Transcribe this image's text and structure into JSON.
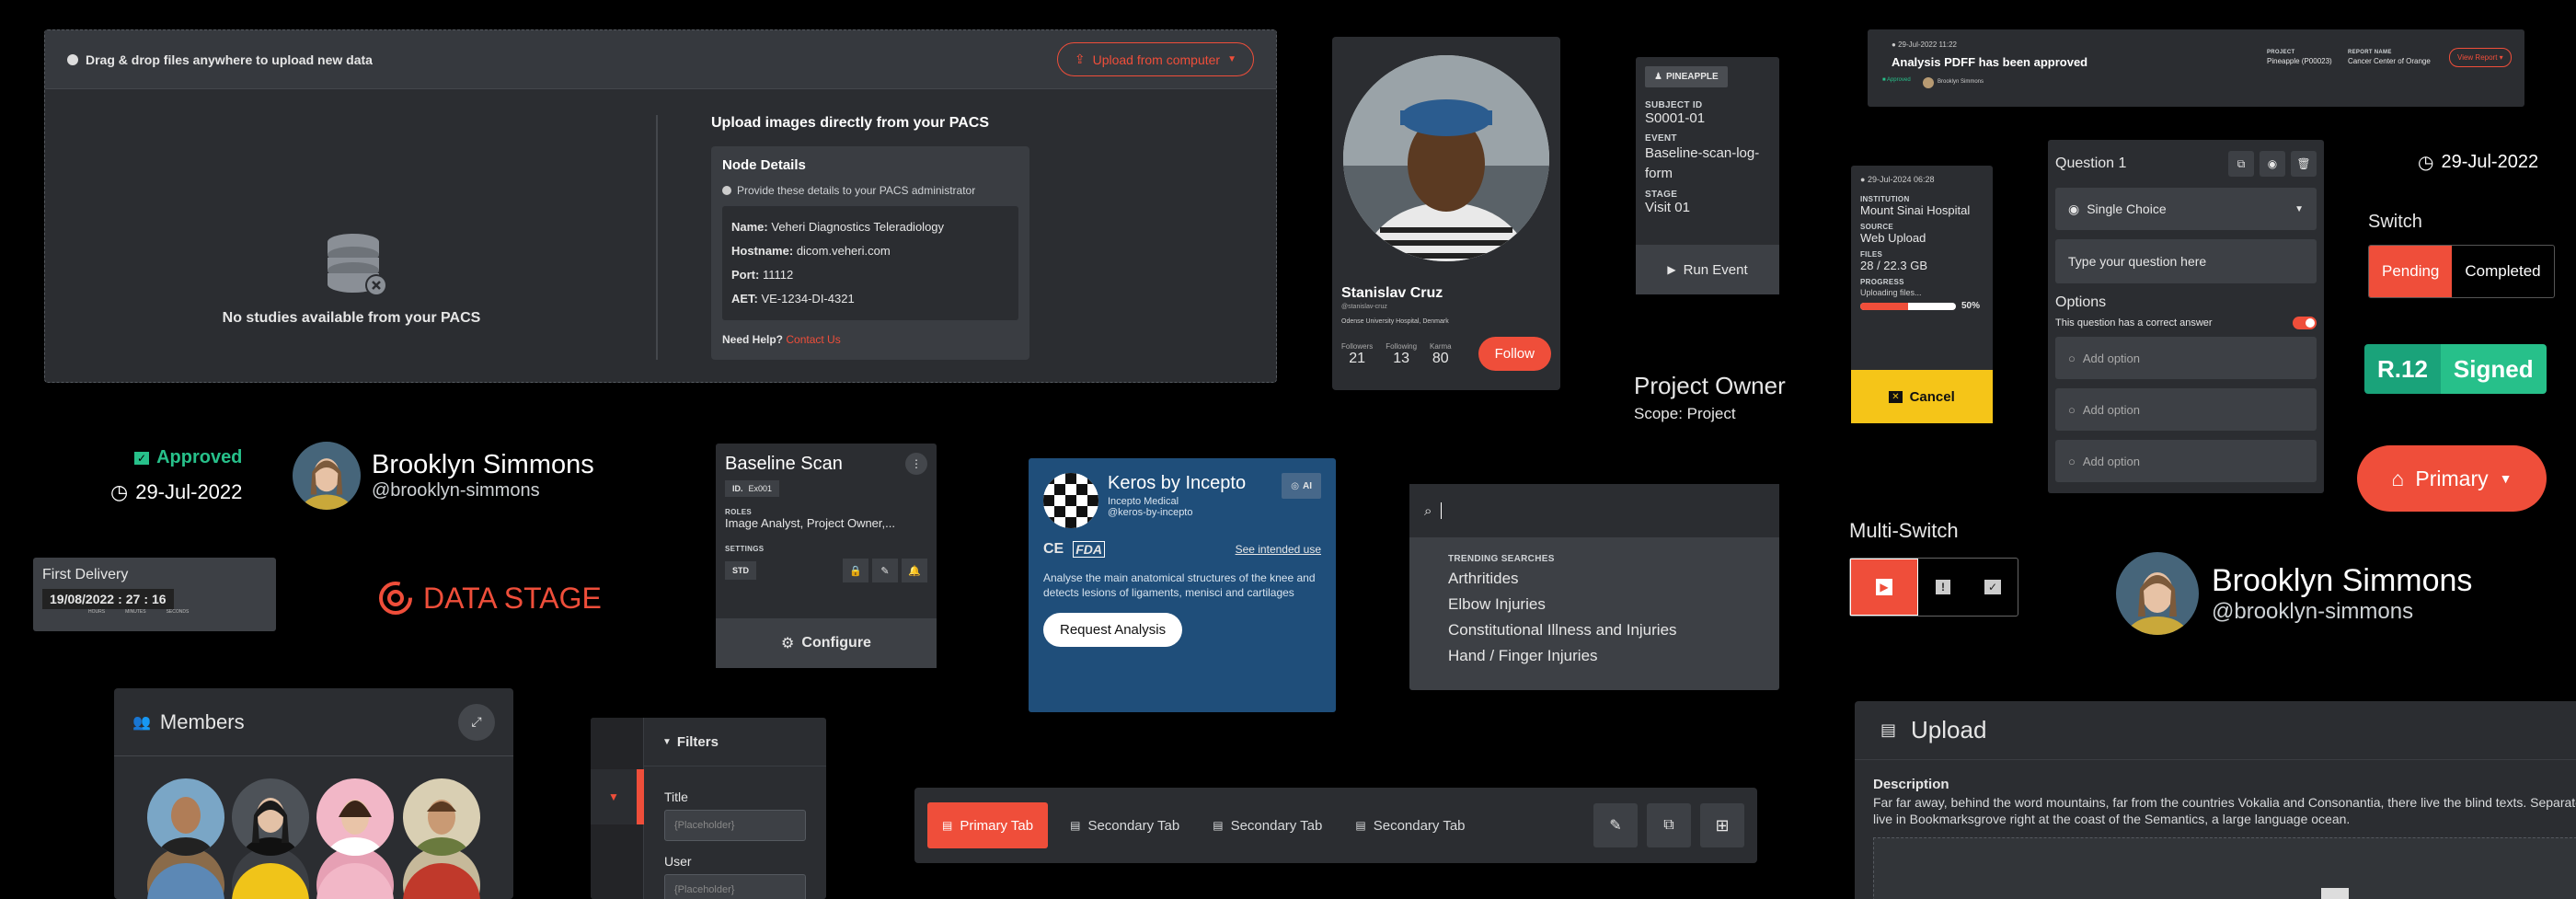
{
  "upload_dropzone": {
    "hint": "Drag & drop files anywhere to upload new data",
    "upload_button": "Upload from computer",
    "empty_text": "No studies available from your PACS",
    "pacs_title": "Upload images directly from your PACS",
    "node_title": "Node Details",
    "node_hint": "Provide these details to your PACS administrator",
    "name_label": "Name:",
    "name_value": "Veheri Diagnostics Teleradiology",
    "host_label": "Hostname:",
    "host_value": "dicom.veheri.com",
    "port_label": "Port:",
    "port_value": "11112",
    "aet_label": "AET:",
    "aet_value": "VE-1234-DI-4321",
    "help_label": "Need Help?",
    "help_link": "Contact Us"
  },
  "profile_card": {
    "name": "Stanislav Cruz",
    "handle": "@stanislav-cruz",
    "location": "Odense University Hospital, Denmark",
    "stats": [
      {
        "label": "Followers",
        "value": "21"
      },
      {
        "label": "Following",
        "value": "13"
      },
      {
        "label": "Karma",
        "value": "80"
      }
    ],
    "follow": "Follow"
  },
  "subject_card": {
    "project": "PINEAPPLE",
    "subject_label": "SUBJECT ID",
    "subject_value": "S0001-01",
    "event_label": "EVENT",
    "event_value": "Baseline-scan-log-form",
    "stage_label": "STAGE",
    "stage_value": "Visit 01",
    "run": "Run Event"
  },
  "notification": {
    "date": "29-Jul-2022 11:22",
    "title": "Analysis PDFF has been approved",
    "status": "Approved",
    "owner": "Brooklyn Simmons",
    "project_label": "PROJECT",
    "project_value": "Pineapple (P00023)",
    "report_label": "REPORT NAME",
    "report_value": "Cancer Center of Orange",
    "view_report": "View Report"
  },
  "upload_progress": {
    "date": "29-Jul-2024 06:28",
    "institution_label": "INSTITUTION",
    "institution_value": "Mount Sinai Hospital",
    "source_label": "SOURCE",
    "source_value": "Web Upload",
    "files_label": "FILES",
    "files_value": "28 / 22.3 GB",
    "progress_label": "PROGRESS",
    "progress_status": "Uploading files...",
    "percent": "50%",
    "fraction": 0.5,
    "cancel": "Cancel"
  },
  "question_editor": {
    "title": "Question 1",
    "type": "Single Choice",
    "placeholder": "Type your question here",
    "options_title": "Options",
    "correct_answer": "This question has a correct answer",
    "options": [
      "Add option",
      "Add option",
      "Add option"
    ]
  },
  "date_tag": {
    "value": "29-Jul-2022"
  },
  "switch": {
    "title": "Switch",
    "left": "Pending",
    "right": "Completed"
  },
  "signed_badge": {
    "code": "R.12",
    "status": "Signed"
  },
  "primary_dropdown": {
    "label": "Primary"
  },
  "project_owner": {
    "title": "Project Owner",
    "scope": "Scope: Project"
  },
  "multi_switch": {
    "title": "Multi-Switch"
  },
  "user_large": {
    "name": "Brooklyn Simmons",
    "handle": "@brooklyn-simmons"
  },
  "approved_tag": {
    "status": "Approved",
    "date": "29-Jul-2022"
  },
  "user_medium": {
    "name": "Brooklyn Simmons",
    "handle": "@brooklyn-simmons"
  },
  "first_delivery": {
    "title": "First Delivery",
    "date": "19/08/2022",
    "hours": "27",
    "minutes": "16",
    "hours_label": "HOURS",
    "minutes_label": "MINUTES",
    "seconds_label": "SECONDS"
  },
  "logo": {
    "text": "DATA STAGE"
  },
  "baseline_scan": {
    "title": "Baseline Scan",
    "id_label": "ID.",
    "id_value": "Ex001",
    "roles_label": "ROLES",
    "roles_value": "Image Analyst, Project Owner,...",
    "settings_label": "SETTINGS",
    "settings_value": "STD",
    "configure": "Configure"
  },
  "keros_card": {
    "title": "Keros by Incepto",
    "badge": "AI",
    "company": "Incepto Medical",
    "handle": "@keros-by-incepto",
    "ce": "CE",
    "fda": "FDA",
    "intended_use": "See intended use",
    "description": "Analyse the main anatomical structures of the knee and detects lesions of ligaments, menisci and cartilages",
    "cta": "Request Analysis"
  },
  "search_panel": {
    "section": "TRENDING SEARCHES",
    "items": [
      "Arthritides",
      "Elbow Injuries",
      "Constitutional Illness and Injuries",
      "Hand / Finger Injuries"
    ]
  },
  "members": {
    "title": "Members"
  },
  "filters": {
    "title": "Filters",
    "title_label": "Title",
    "title_placeholder": "{Placeholder}",
    "user_label": "User",
    "user_placeholder": "{Placeholder}"
  },
  "tabs": {
    "items": [
      "Primary Tab",
      "Secondary Tab",
      "Secondary Tab",
      "Secondary Tab"
    ]
  },
  "upload_panel": {
    "title": "Upload",
    "description_label": "Description",
    "description_text": "Far far away, behind the word mountains, far from the countries Vokalia and Consonantia, there live the blind texts. Separated they live in Bookmarksgrove right at the coast of the Semantics, a large language ocean."
  },
  "colors": {
    "accent": "#ef4e3a",
    "success": "#27c08a",
    "warning": "#f5c518",
    "panel": "#2b2d31",
    "blue": "#1f4e7a"
  }
}
